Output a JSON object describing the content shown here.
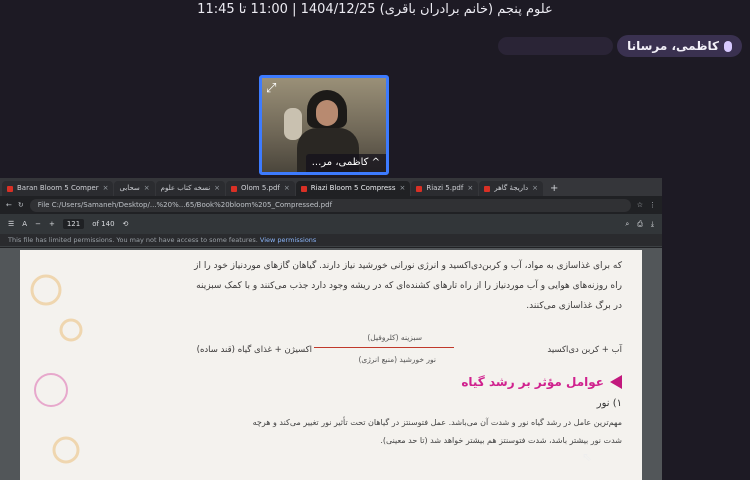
{
  "meeting": {
    "title": "علوم پنجم (خانم برادران باقری) 1404/12/25 | 11:00 تا 11:45"
  },
  "speaker": {
    "name": "کاظمی، مرسانا",
    "icon": "mic-icon"
  },
  "video": {
    "label": "^ کاظمی، مر...",
    "expand_icon": "expand-icon"
  },
  "browser": {
    "tabs": [
      {
        "label": "Baran Bloom 5 Comper",
        "close": "×"
      },
      {
        "label": "سحابی",
        "close": "×"
      },
      {
        "label": "نسخه کتاب علوم",
        "close": "×"
      },
      {
        "label": "Olom 5.pdf",
        "close": "×"
      },
      {
        "label": "Riazi Bloom 5 Compress",
        "close": "×"
      },
      {
        "label": "Riazi 5.pdf",
        "close": "×"
      },
      {
        "label": "داریجهٔ گاهر",
        "close": "×"
      }
    ],
    "newtab": "+",
    "url": "File  C:/Users/Samaneh/Desktop/...%20%...65/Book%20bloom%205_Compressed.pdf",
    "pdf_toolbar": {
      "zoom_label": "A",
      "page_current": "121",
      "page_total": "of 140"
    },
    "permission_text": "This file has limited permissions. You may not have access to some features.",
    "permission_link": "View permissions"
  },
  "pdf": {
    "line1": "که برای غذاسازی به مواد، آب و کربن‌دی‌اکسید و انرژی نورانی خورشید نیاز دارند. گیاهان گازهای موردنیاز خود را از",
    "line2": "راه روزنه‌های هوایی و آب موردنیاز را از راه تارهای کشنده‌ای که در ریشه وجود دارد جذب می‌کنند و با کمک سبزینه",
    "line3": "در برگ غذاسازی می‌کنند.",
    "eq_right": "آب + کربن دی‌اکسید",
    "eq_top": "سبزینه (کلروفیل)",
    "eq_bottom": "نور خورشید (منبع انرژی)",
    "eq_left": "اکسیژن + غذای گیاه (قند ساده)",
    "heading": "عوامل مؤثر بر رشد گیاه",
    "subheading": "۱) نور",
    "para1": "مهم‌ترین عامل در رشد گیاه نور و شدت آن می‌باشد. عمل فتوسنتز در گیاهان تحت تأثیر نور تغییر می‌کند و هرچه",
    "para2": "شدت نور بیشتر باشد، شدت فتوسنتز هم بیشتر خواهد شد (تا حد معینی)."
  }
}
